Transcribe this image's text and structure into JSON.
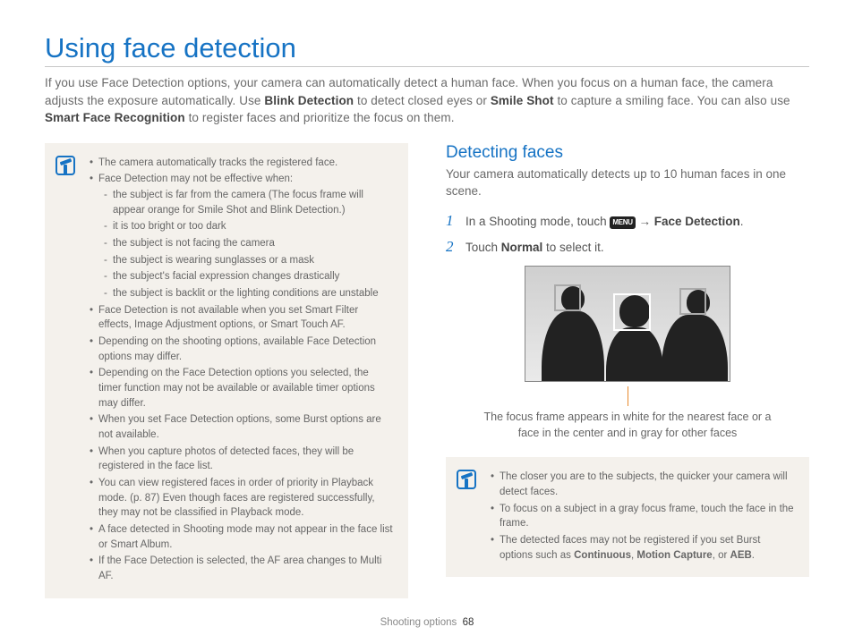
{
  "title": "Using face detection",
  "intro_parts": {
    "t1": "If you use Face Detection options, your camera can automatically detect a human face. When you focus on a human face, the camera adjusts the exposure automatically. Use ",
    "b1": "Blink Detection",
    "t2": " to detect closed eyes or ",
    "b2": "Smile Shot",
    "t3": " to capture a smiling face. You can also use ",
    "b3": "Smart Face Recognition",
    "t4": " to register faces and prioritize the focus on them."
  },
  "left_notes": {
    "i0": "The camera automatically tracks the registered face.",
    "i1": "Face Detection may not be effective when:",
    "i1_sub": {
      "s0": "the subject is far from the camera (The focus frame will appear orange for Smile Shot and Blink Detection.)",
      "s1": "it is too bright or too dark",
      "s2": "the subject is not facing the camera",
      "s3": "the subject is wearing sunglasses or a mask",
      "s4": "the subject's facial expression changes drastically",
      "s5": "the subject is backlit or the lighting conditions are unstable"
    },
    "i2": "Face Detection is not available when you set Smart Filter effects, Image Adjustment options, or Smart Touch AF.",
    "i3": "Depending on the shooting options, available Face Detection options may differ.",
    "i4": "Depending on the Face Detection options you selected, the timer function may not be available or available timer options may differ.",
    "i5": "When you set Face Detection options, some Burst options are not available.",
    "i6": "When you capture photos of detected faces, they will be registered in the face list.",
    "i7": "You can view registered faces in order of priority in Playback mode. (p. 87) Even though faces are registered successfully, they may not be classified in Playback mode.",
    "i8": "A face detected in Shooting mode may not appear in the face list or Smart Album.",
    "i9": "If the Face Detection is selected, the AF area changes to Multi AF."
  },
  "right": {
    "heading": "Detecting faces",
    "intro": "Your camera automatically detects up to 10 human faces in one scene.",
    "step1_a": "In a Shooting mode, touch ",
    "menu_label": "MENU",
    "step1_b": " → ",
    "step1_c": "Face Detection",
    "step1_d": ".",
    "step2_a": "Touch ",
    "step2_b": "Normal",
    "step2_c": " to select it.",
    "num1": "1",
    "num2": "2",
    "caption": "The focus frame appears in white for the nearest face or a face in the center and in gray for other faces",
    "tips": {
      "t0": "The closer you are to the subjects, the quicker your camera will detect faces.",
      "t1": "To focus on a subject in a gray focus frame, touch the face in the frame.",
      "t2_a": "The detected faces may not be registered if you set Burst options such as ",
      "t2_b1": "Continuous",
      "t2_s1": ", ",
      "t2_b2": "Motion Capture",
      "t2_s2": ", or ",
      "t2_b3": "AEB",
      "t2_s3": "."
    }
  },
  "footer": {
    "section": "Shooting options",
    "page": "68"
  }
}
